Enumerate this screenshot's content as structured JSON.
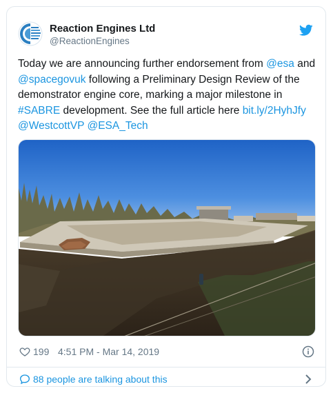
{
  "tweet": {
    "author_name": "Reaction Engines Ltd",
    "author_handle": "@ReactionEngines",
    "text": {
      "t1": "Today we are announcing further endorsement from ",
      "m_esa": "@esa",
      "t2": " and ",
      "m_spacegovuk": "@spacegovuk",
      "t3": " following a Preliminary Design Review of the demonstrator engine core, marking a major milestone in ",
      "h_sabre": "#SABRE",
      "t4": " development. See the full article here ",
      "link": "bit.ly/2HyhJfy",
      "t5": " ",
      "m_westcott": "@WestcottVP",
      "t6": " ",
      "m_esatech": "@ESA_Tech"
    },
    "like_count": "199",
    "timestamp": "4:51 PM - Mar 14, 2019",
    "talking": "88 people are talking about this"
  },
  "icons": {
    "twitter": "twitter-bird-icon",
    "heart": "heart-icon",
    "info": "info-icon",
    "comment": "comment-bubble-icon",
    "chevron": "chevron-right-icon"
  },
  "colors": {
    "link": "#1b95e0",
    "text": "#14171a",
    "muted": "#657786",
    "border": "#e1e8ed"
  }
}
